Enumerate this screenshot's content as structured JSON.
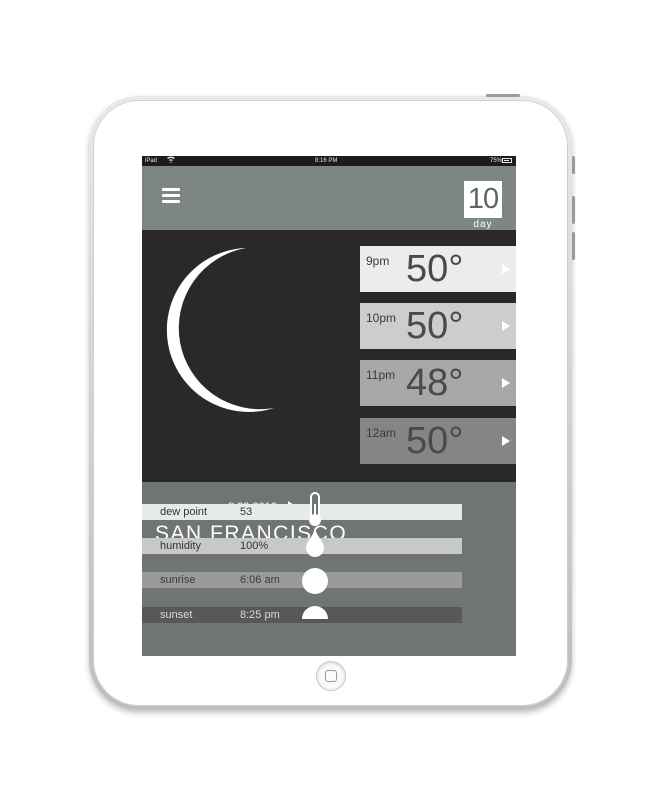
{
  "status_bar": {
    "device": "iPad",
    "time": "8:16 PM",
    "battery": "75%"
  },
  "header": {
    "forecast_number": "10",
    "forecast_unit": "day",
    "menu_icon": "hamburger-menu-icon"
  },
  "current": {
    "date": "8 20 2013",
    "city": "SAN FRANCISCO",
    "condition_icon": "crescent-moon-icon"
  },
  "hourly": [
    {
      "time": "9pm",
      "temp": "50°"
    },
    {
      "time": "10pm",
      "temp": "50°"
    },
    {
      "time": "11pm",
      "temp": "48°"
    },
    {
      "time": "12am",
      "temp": "50°"
    }
  ],
  "details": [
    {
      "label": "dew point",
      "value": "53",
      "icon": "thermometer-icon"
    },
    {
      "label": "humidity",
      "value": "100%",
      "icon": "water-drop-icon"
    },
    {
      "label": "sunrise",
      "value": "6:06 am",
      "icon": "sun-icon"
    },
    {
      "label": "sunset",
      "value": "8:25 pm",
      "icon": "half-sun-icon"
    }
  ],
  "colors": {
    "screen_bg": "#6e7574",
    "hero_bg": "#2a2828",
    "accent_white": "#ffffff"
  }
}
